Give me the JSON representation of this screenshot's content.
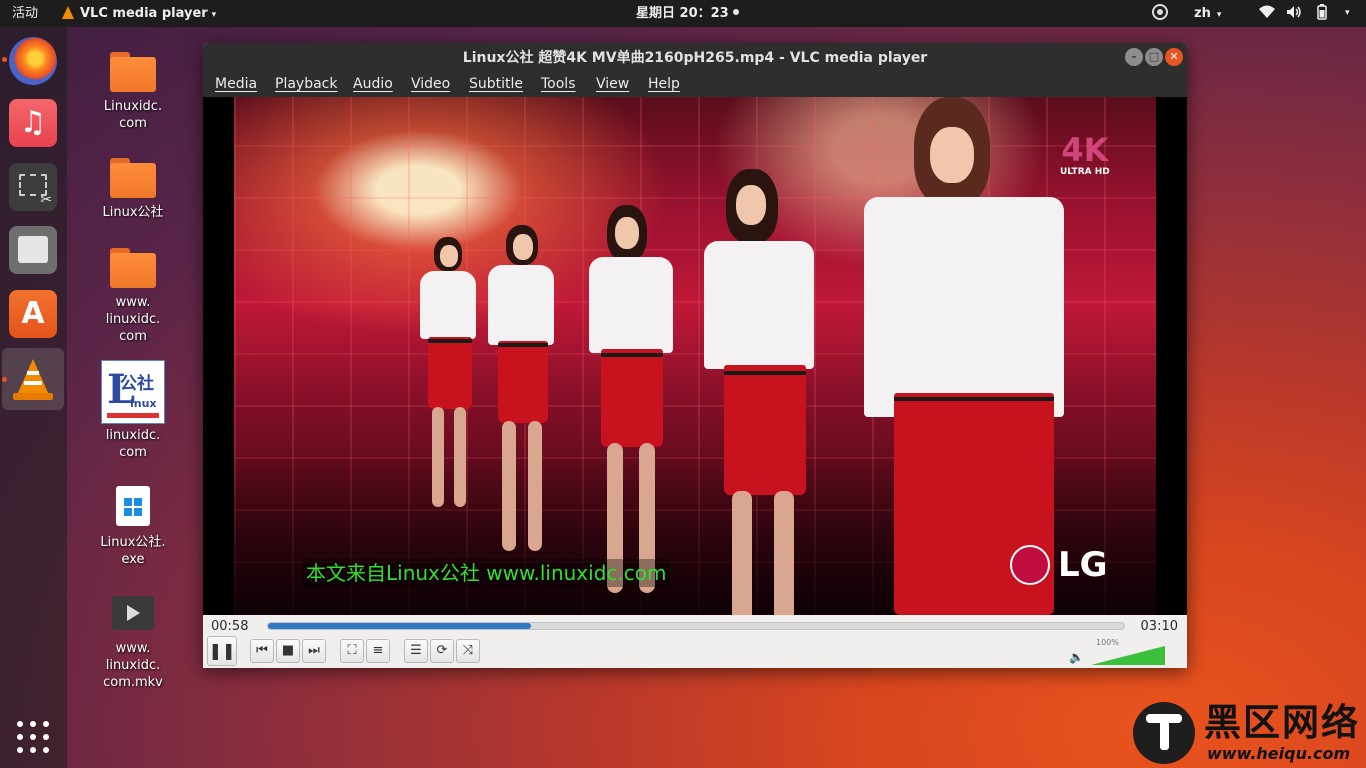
{
  "topbar": {
    "activities": "活动",
    "app_menu": "VLC media player",
    "clock": "星期日 20：23",
    "lang": "zh",
    "caret": "▾"
  },
  "dock": {
    "items": [
      "firefox",
      "rhythmbox",
      "screenshot",
      "files",
      "ubuntu-software",
      "vlc"
    ]
  },
  "desktop": {
    "icons": [
      {
        "label": "Linuxidc.\ncom"
      },
      {
        "label": "Linux公社"
      },
      {
        "label": "www.\nlinuxidc.\ncom"
      },
      {
        "label": "linuxidc.\ncom"
      },
      {
        "label": "Linux公社.\nexe"
      },
      {
        "label": "www.\nlinuxidc.\ncom.mkv"
      }
    ],
    "thumb_text": {
      "L": "L",
      "gs": "公社",
      "lx": "inux"
    }
  },
  "vlc": {
    "title": "Linux公社 超赞4K MV单曲2160pH265.mp4 - VLC media player",
    "menu": [
      "Media",
      "Playback",
      "Audio",
      "Video",
      "Subtitle",
      "Tools",
      "View",
      "Help"
    ],
    "time_current": "00:58",
    "time_total": "03:10",
    "progress": 0.307,
    "volume_label": "100%",
    "volume": 1.0
  },
  "video_overlay": {
    "subtitle": "本文来自Linux公社 www.linuxidc.com",
    "lg": "LG",
    "uhd_big": "4K",
    "uhd_small": "ULTRA HD"
  },
  "watermark": {
    "title": "黑区网络",
    "url": "www.heiqu.com"
  },
  "colors": {
    "accent": "#e95420",
    "progress": "#2f78c5",
    "volume": "#3cc03c"
  }
}
